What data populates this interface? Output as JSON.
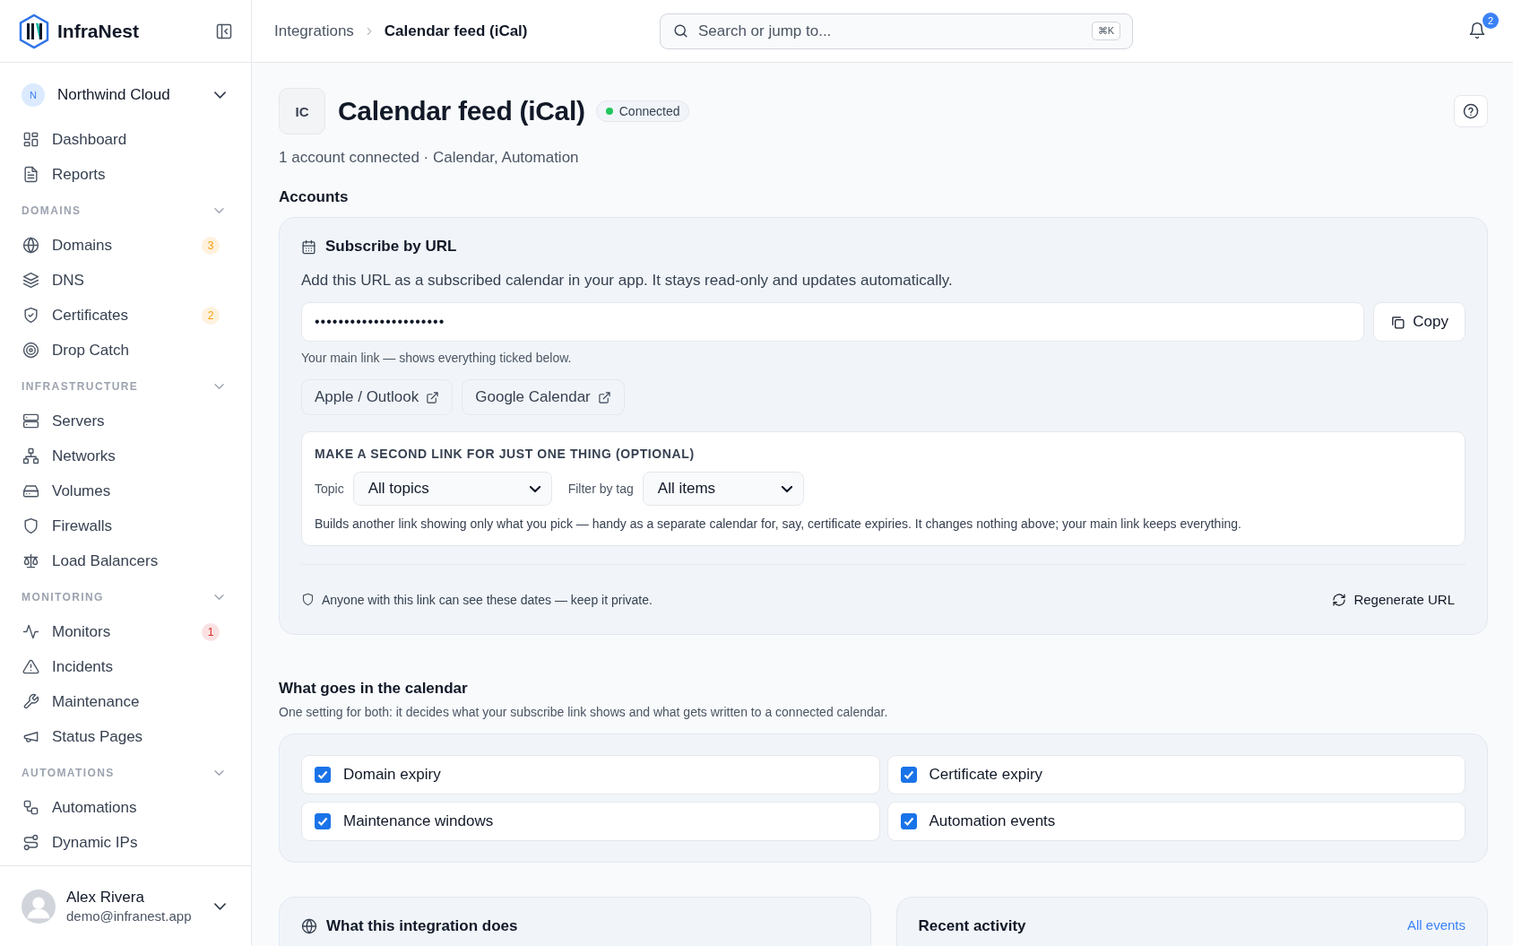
{
  "sidebar": {
    "brand": "InfraNest",
    "org": {
      "initial": "N",
      "name": "Northwind Cloud"
    },
    "top_items": [
      {
        "label": "Dashboard"
      },
      {
        "label": "Reports"
      }
    ],
    "groups": [
      {
        "title": "DOMAINS",
        "items": [
          {
            "label": "Domains",
            "badge": "3",
            "color": "#f59e0b"
          },
          {
            "label": "DNS"
          },
          {
            "label": "Certificates",
            "badge": "2",
            "color": "#f59e0b"
          },
          {
            "label": "Drop Catch"
          }
        ]
      },
      {
        "title": "INFRASTRUCTURE",
        "items": [
          {
            "label": "Servers"
          },
          {
            "label": "Networks"
          },
          {
            "label": "Volumes"
          },
          {
            "label": "Firewalls"
          },
          {
            "label": "Load Balancers"
          }
        ]
      },
      {
        "title": "MONITORING",
        "items": [
          {
            "label": "Monitors",
            "badge": "1",
            "color": "#dc2626"
          },
          {
            "label": "Incidents"
          },
          {
            "label": "Maintenance"
          },
          {
            "label": "Status Pages"
          }
        ]
      },
      {
        "title": "AUTOMATIONS",
        "items": [
          {
            "label": "Automations"
          },
          {
            "label": "Dynamic IPs"
          }
        ]
      }
    ],
    "user": {
      "name": "Alex Rivera",
      "email": "demo@infranest.app"
    }
  },
  "header": {
    "breadcrumb": [
      "Integrations",
      "Calendar feed (iCal)"
    ],
    "search": {
      "placeholder": "Search or jump to...",
      "shortcut": "⌘K"
    },
    "notifications": "2"
  },
  "page": {
    "initials": "IC",
    "title": "Calendar feed (iCal)",
    "status": "Connected",
    "subtitle": "1 account connected · Calendar, Automation"
  },
  "accounts": {
    "heading": "Accounts",
    "card_title": "Subscribe by URL",
    "description": "Add this URL as a subscribed calendar in your app. It stays read-only and updates automatically.",
    "url": "••••••••••••••••••••••",
    "copy": "Copy",
    "hint": "Your main link — shows everything ticked below.",
    "open_in": [
      "Apple / Outlook",
      "Google Calendar"
    ],
    "second_link": {
      "heading": "MAKE A SECOND LINK FOR JUST ONE THING (OPTIONAL)",
      "filters": [
        {
          "label": "Topic",
          "value": "All topics"
        },
        {
          "label": "Filter by tag",
          "value": "All items"
        }
      ],
      "note": "Builds another link showing only what you pick — handy as a separate calendar for, say, certificate expiries. It changes nothing above; your main link keeps everything."
    },
    "privacy": "Anyone with this link can see these dates — keep it private.",
    "regenerate": "Regenerate URL"
  },
  "calendar": {
    "heading": "What goes in the calendar",
    "description": "One setting for both: it decides what your subscribe link shows and what gets written to a connected calendar.",
    "options": [
      {
        "label": "Domain expiry",
        "checked": true
      },
      {
        "label": "Certificate expiry",
        "checked": true
      },
      {
        "label": "Maintenance windows",
        "checked": true
      },
      {
        "label": "Automation events",
        "checked": true
      }
    ]
  },
  "panels": [
    {
      "title": "What this integration does"
    },
    {
      "title": "Recent activity",
      "link": "All events"
    }
  ]
}
